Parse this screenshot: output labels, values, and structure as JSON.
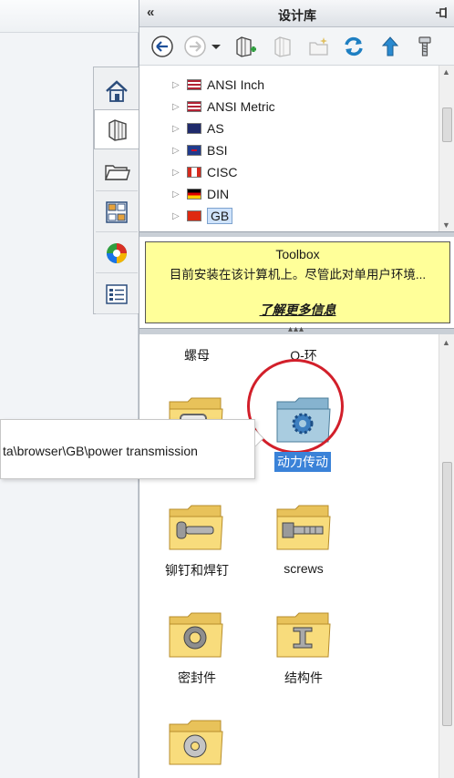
{
  "panel": {
    "title": "设计库",
    "collapse_glyph": "«"
  },
  "toolbar": {
    "buttons": [
      "back-icon",
      "forward-icon",
      "dropdown-icon",
      "add-library-icon",
      "library-icon",
      "new-folder-icon",
      "refresh-icon",
      "up-folder-icon",
      "toolbox-icon"
    ]
  },
  "vertical_tabs": [
    "home-icon",
    "design-library-icon",
    "file-explorer-icon",
    "view-palette-icon",
    "appearances-icon",
    "custom-properties-icon"
  ],
  "tree": {
    "items": [
      {
        "label": "ANSI Inch",
        "flag": "us"
      },
      {
        "label": "ANSI Metric",
        "flag": "us"
      },
      {
        "label": "AS",
        "flag": "au"
      },
      {
        "label": "BSI",
        "flag": "gb"
      },
      {
        "label": "CISC",
        "flag": "ca"
      },
      {
        "label": "DIN",
        "flag": "de"
      },
      {
        "label": "GB",
        "flag": "cn",
        "selected": true
      }
    ]
  },
  "notice": {
    "title": "Toolbox",
    "body": "目前安装在该计算机上。尽管此对单用户环境...",
    "link": "了解更多信息"
  },
  "files": {
    "items": [
      {
        "caption": "螺母",
        "icon": "folder-icon"
      },
      {
        "caption": "O-环",
        "icon": "folder-icon"
      },
      {
        "caption": "",
        "icon": "folder-icon"
      },
      {
        "caption": "动力传动",
        "icon": "gear-folder-icon",
        "selected": true
      },
      {
        "caption": "铆钉和焊钉",
        "icon": "bolt-folder-icon"
      },
      {
        "caption": "screws",
        "icon": "screw-folder-icon"
      },
      {
        "caption": "密封件",
        "icon": "seal-folder-icon"
      },
      {
        "caption": "结构件",
        "icon": "ibeam-folder-icon"
      },
      {
        "caption": "",
        "icon": "washer-folder-icon"
      }
    ]
  },
  "tooltip": {
    "text": "ta\\browser\\GB\\power transmission"
  },
  "colors": {
    "accent": "#3a82d8",
    "highlight_circle": "#d21f2a",
    "notice_bg": "#ffff99"
  }
}
